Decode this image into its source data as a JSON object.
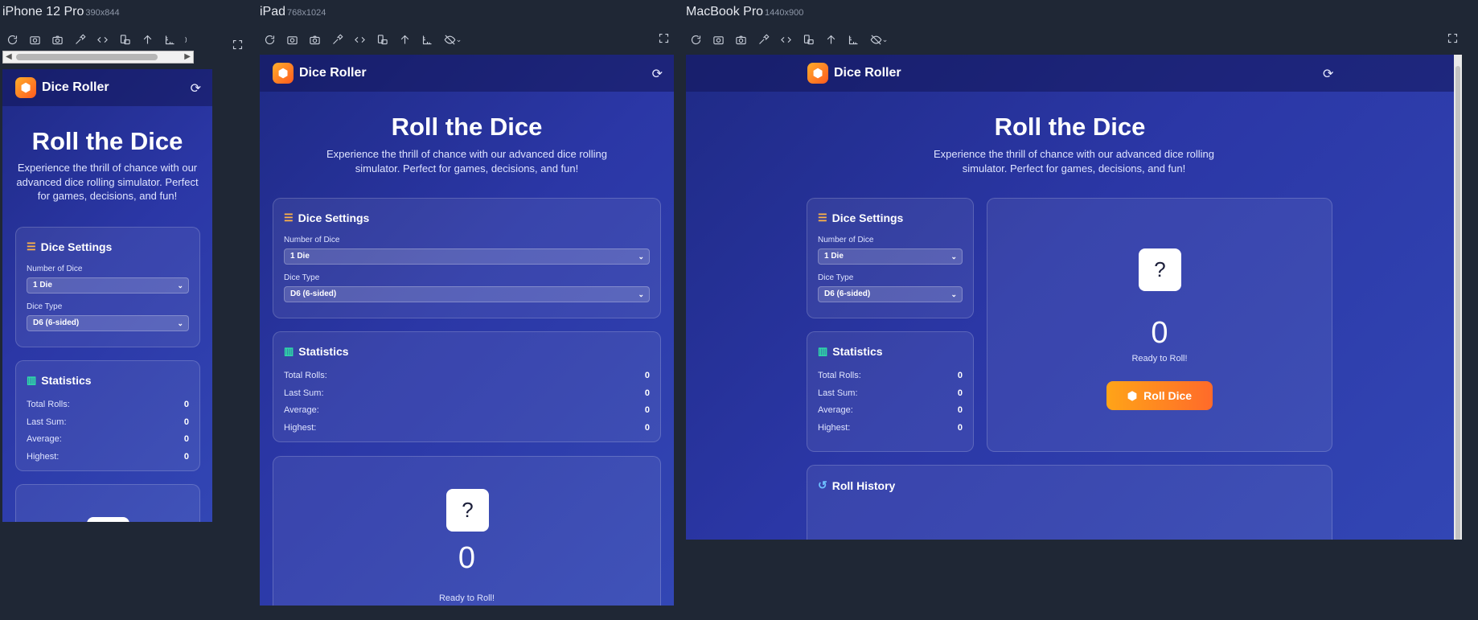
{
  "devices": [
    {
      "name": "iPhone 12 Pro",
      "dims": "390x844"
    },
    {
      "name": "iPad",
      "dims": "768x1024"
    },
    {
      "name": "MacBook Pro",
      "dims": "1440x900"
    }
  ],
  "app": {
    "brand": "Dice Roller",
    "hero_title": "Roll the Dice",
    "hero_subtitle": "Experience the thrill of chance with our advanced dice rolling simulator. Perfect for games, decisions, and fun!",
    "settings": {
      "title": "Dice Settings",
      "num_label": "Number of Dice",
      "num_value": "1 Die",
      "type_label": "Dice Type",
      "type_value": "D6 (6-sided)"
    },
    "stats": {
      "title": "Statistics",
      "rows": [
        {
          "label": "Total Rolls:",
          "value": "0"
        },
        {
          "label": "Last Sum:",
          "value": "0"
        },
        {
          "label": "Average:",
          "value": "0"
        },
        {
          "label": "Highest:",
          "value": "0"
        }
      ]
    },
    "dice_face": "?",
    "total": "0",
    "status": "Ready to Roll!",
    "roll_button": "Roll Dice",
    "history_title": "Roll History"
  },
  "colors": {
    "background": "#1f2735",
    "accent": "#ff8a1f",
    "gradient_start": "#1f2a86",
    "gradient_end": "#3246b4"
  }
}
